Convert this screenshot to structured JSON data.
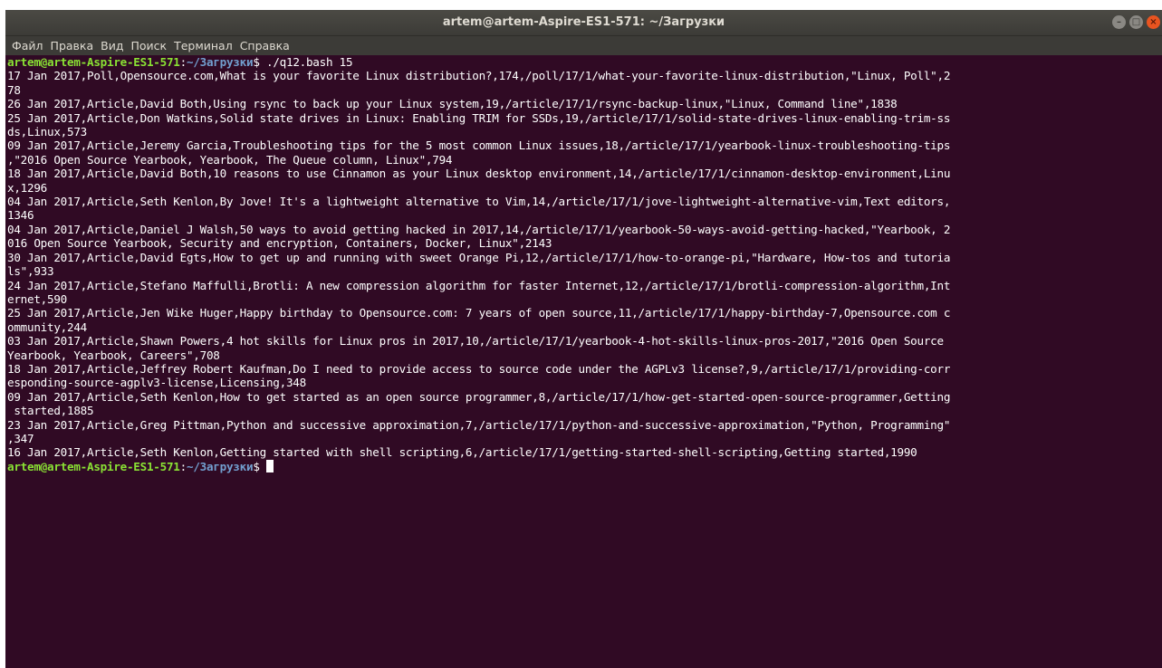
{
  "window": {
    "title": "artem@artem-Aspire-ES1-571: ~/Загрузки",
    "controls": {
      "minimize": "–",
      "maximize": "□",
      "close": "×"
    }
  },
  "menu": [
    "Файл",
    "Правка",
    "Вид",
    "Поиск",
    "Терминал",
    "Справка"
  ],
  "terminal": {
    "prompt_user": "artem@artem-Aspire-ES1-571",
    "prompt_sep": ":",
    "prompt_path": "~/Загрузки",
    "prompt_dollar": "$ ",
    "command": "./q12.bash 15",
    "output": [
      "17 Jan 2017,Poll,Opensource.com,What is your favorite Linux distribution?,174,/poll/17/1/what-your-favorite-linux-distribution,\"Linux, Poll\",2",
      "78",
      "26 Jan 2017,Article,David Both,Using rsync to back up your Linux system,19,/article/17/1/rsync-backup-linux,\"Linux, Command line\",1838",
      "25 Jan 2017,Article,Don Watkins,Solid state drives in Linux: Enabling TRIM for SSDs,19,/article/17/1/solid-state-drives-linux-enabling-trim-ss",
      "ds,Linux,573",
      "09 Jan 2017,Article,Jeremy Garcia,Troubleshooting tips for the 5 most common Linux issues,18,/article/17/1/yearbook-linux-troubleshooting-tips",
      ",\"2016 Open Source Yearbook, Yearbook, The Queue column, Linux\",794",
      "18 Jan 2017,Article,David Both,10 reasons to use Cinnamon as your Linux desktop environment,14,/article/17/1/cinnamon-desktop-environment,Linu",
      "x,1296",
      "04 Jan 2017,Article,Seth Kenlon,By Jove! It's a lightweight alternative to Vim,14,/article/17/1/jove-lightweight-alternative-vim,Text editors,",
      "1346",
      "04 Jan 2017,Article,Daniel J Walsh,50 ways to avoid getting hacked in 2017,14,/article/17/1/yearbook-50-ways-avoid-getting-hacked,\"Yearbook, 2",
      "016 Open Source Yearbook, Security and encryption, Containers, Docker, Linux\",2143",
      "30 Jan 2017,Article,David Egts,How to get up and running with sweet Orange Pi,12,/article/17/1/how-to-orange-pi,\"Hardware, How-tos and tutoria",
      "ls\",933",
      "24 Jan 2017,Article,Stefano Maffulli,Brotli: A new compression algorithm for faster Internet,12,/article/17/1/brotli-compression-algorithm,Int",
      "ernet,590",
      "25 Jan 2017,Article,Jen Wike Huger,Happy birthday to Opensource.com: 7 years of open source,11,/article/17/1/happy-birthday-7,Opensource.com c",
      "ommunity,244",
      "03 Jan 2017,Article,Shawn Powers,4 hot skills for Linux pros in 2017,10,/article/17/1/yearbook-4-hot-skills-linux-pros-2017,\"2016 Open Source",
      "Yearbook, Yearbook, Careers\",708",
      "18 Jan 2017,Article,Jeffrey Robert Kaufman,Do I need to provide access to source code under the AGPLv3 license?,9,/article/17/1/providing-corr",
      "esponding-source-agplv3-license,Licensing,348",
      "09 Jan 2017,Article,Seth Kenlon,How to get started as an open source programmer,8,/article/17/1/how-get-started-open-source-programmer,Getting",
      " started,1885",
      "23 Jan 2017,Article,Greg Pittman,Python and successive approximation,7,/article/17/1/python-and-successive-approximation,\"Python, Programming\"",
      ",347",
      "16 Jan 2017,Article,Seth Kenlon,Getting started with shell scripting,6,/article/17/1/getting-started-shell-scripting,Getting started,1990"
    ]
  },
  "colors": {
    "background": "#300a24",
    "titlebar": "#3c3b37",
    "prompt_user": "#8ae234",
    "prompt_path": "#729fcf",
    "text": "#ffffff",
    "close_button": "#e95420"
  }
}
